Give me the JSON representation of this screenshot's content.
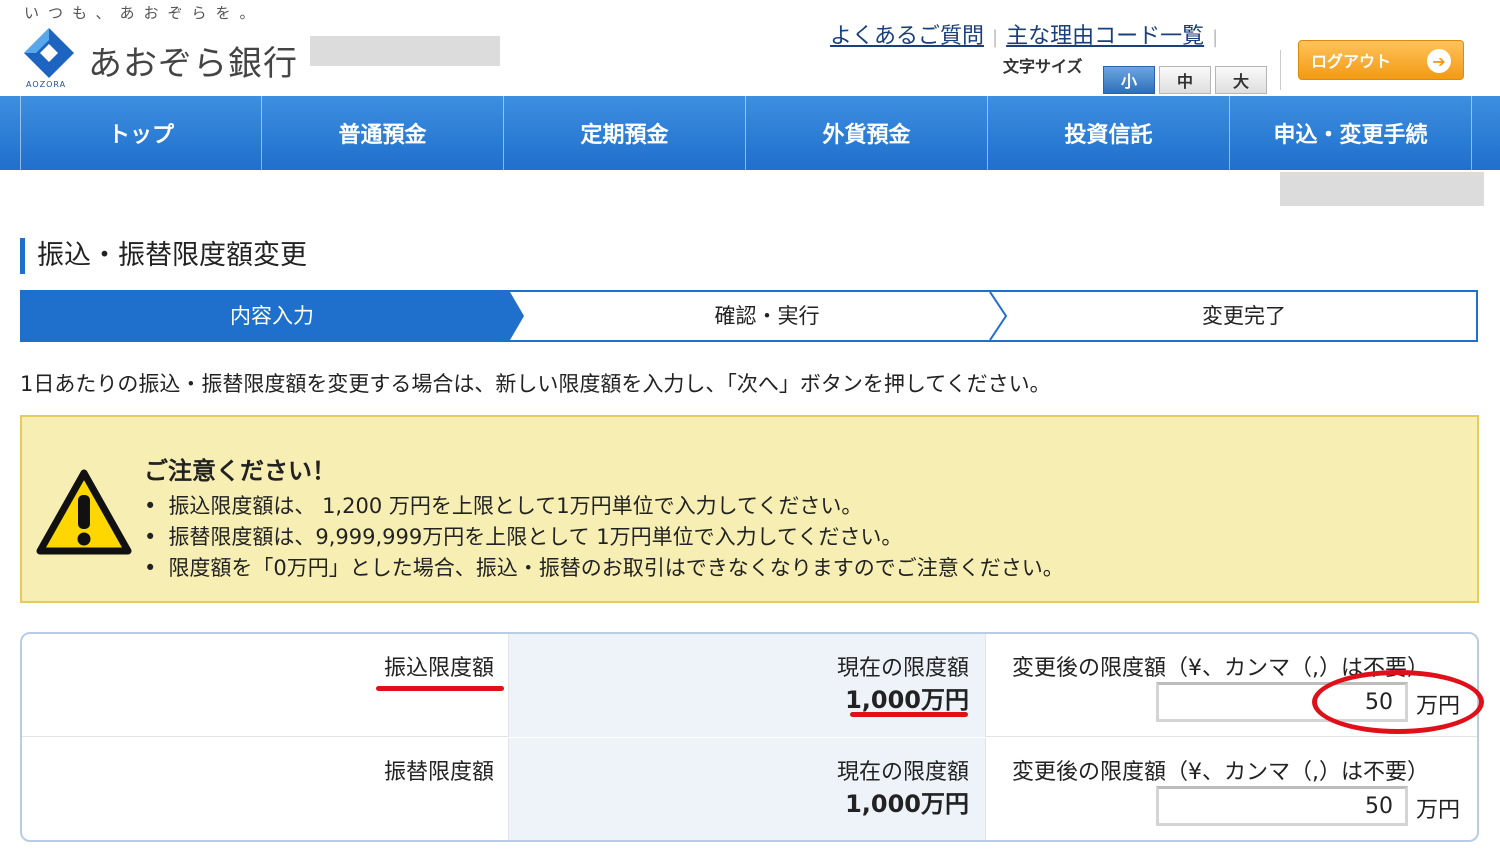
{
  "header": {
    "tagline": "いつも、あおぞらを。",
    "logo_text": "あおぞら銀行",
    "logo_sub": "AOZORA",
    "links": [
      "よくあるご質問",
      "主な理由コード一覧"
    ],
    "font_size_label": "文字サイズ",
    "font_sizes": [
      "小",
      "中",
      "大"
    ],
    "font_size_selected": "小",
    "logout_label": "ログアウト"
  },
  "nav": {
    "items": [
      "トップ",
      "普通預金",
      "定期預金",
      "外貨預金",
      "投資信託",
      "申込・変更手続"
    ]
  },
  "page": {
    "title": "振込・振替限度額変更",
    "steps": [
      "内容入力",
      "確認・実行",
      "変更完了"
    ],
    "active_step": 0,
    "instruction": "1日あたりの振込・振替限度額を変更する場合は、新しい限度額を入力し、「次へ」ボタンを押してください。"
  },
  "warning": {
    "title": "ご注意ください！",
    "items": [
      "振込限度額は、 1,200 万円を上限として1万円単位で入力してください。",
      "振替限度額は、9,999,999万円を上限として 1万円単位で入力してください。",
      "限度額を「0万円」とした場合、振込・振替のお取引はできなくなりますのでご注意ください。"
    ]
  },
  "limits": {
    "rows": [
      {
        "label": "振込限度額",
        "current_label": "現在の限度額",
        "current_value": "1,000万円",
        "new_label": "変更後の限度額（¥、カンマ（,）は不要）",
        "new_value": "50",
        "unit": "万円"
      },
      {
        "label": "振替限度額",
        "current_label": "現在の限度額",
        "current_value": "1,000万円",
        "new_label": "変更後の限度額（¥、カンマ（,）は不要）",
        "new_value": "50",
        "unit": "万円"
      }
    ]
  },
  "colors": {
    "brand_blue": "#1f6fcc",
    "warning_bg": "#f6eeb3",
    "annotation_red": "#e0101a",
    "logout_orange": "#f29a14"
  }
}
